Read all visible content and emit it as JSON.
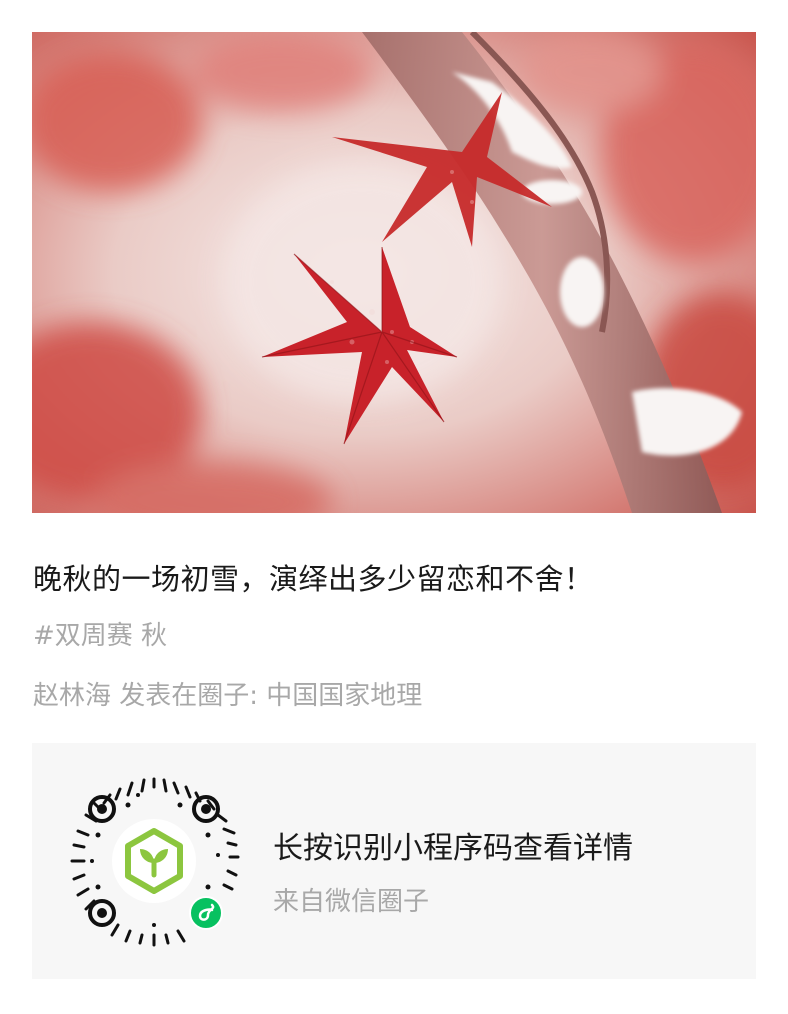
{
  "post": {
    "image_subject": "maple-leaves-snow-photo",
    "title": "晚秋的一场初雪，演绎出多少留恋和不舍！",
    "tag": "#双周赛 秋",
    "author_line": "赵林海 发表在圈子: 中国国家地理"
  },
  "mini_program": {
    "qr_icon": "mini-program-qr-icon",
    "main_text": "长按识别小程序码查看详情",
    "sub_text": "来自微信圈子"
  },
  "colors": {
    "title": "#1a1a1a",
    "muted": "#a8a8a8",
    "card_bg": "#f7f7f7",
    "leaf_red": "#c8222a",
    "qr_green": "#8cc63f",
    "badge_green": "#07c160"
  }
}
